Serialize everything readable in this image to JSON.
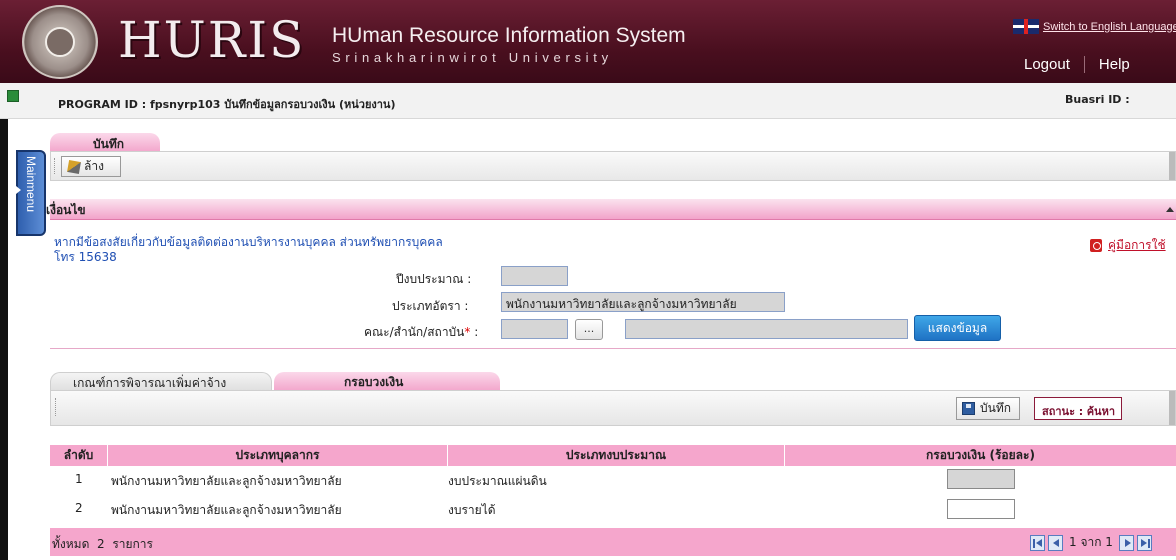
{
  "header": {
    "brand": "HURIS",
    "system_title": "HUman Resource Information System",
    "system_subtitle": "Srinakharinwirot University",
    "switch_language": "Switch to English Language",
    "nav": {
      "logout": "Logout",
      "help": "Help"
    }
  },
  "program_bar": {
    "program_id": "PROGRAM ID : fpsnyrp103 บันทึกข้อมูลกรอบวงเงิน (หน่วยงาน)",
    "buasri_label": "Buasri ID :"
  },
  "sidebar": {
    "mainmenu_label": "Mainmenu"
  },
  "save_tab": {
    "label": "บันทึก"
  },
  "toolbar": {
    "clear_label": "ล้าง"
  },
  "condition": {
    "title": "เงื่อนไข",
    "contact_line1": "หากมีข้อสงสัยเกี่ยวกับข้อมูลติดต่องานบริหารงานบุคคล ส่วนทรัพยากรบุคคล",
    "contact_line2": "โทร 15638",
    "manual_link": "คู่มือการใช้",
    "fields": {
      "fiscal_year_label": "ปีงบประมาณ :",
      "fiscal_year_value": "",
      "rate_type_label": "ประเภทอัตรา :",
      "rate_type_value": "พนักงานมหาวิทยาลัยและลูกจ้างมหาวิทยาลัย",
      "faculty_label": "คณะ/สำนัก/สถาบัน",
      "faculty_required_mark": "*",
      "faculty_colon": " :",
      "faculty_code_value": "",
      "faculty_name_value": "",
      "browse_label": "..."
    },
    "show_button": "แสดงข้อมูล"
  },
  "lower_tabs": {
    "criteria": "เกณฑ์การพิจารณาเพิ่มค่าจ้าง",
    "budget": "กรอบวงเงิน"
  },
  "toolbar2": {
    "save_label": "บันทึก",
    "status_label": "สถานะ :",
    "status_value": "ค้นหา"
  },
  "table": {
    "columns": [
      "ลำดับ",
      "ประเภทบุคลากร",
      "ประเภทงบประมาณ",
      "กรอบวงเงิน (ร้อยละ)"
    ],
    "rows": [
      {
        "no": "1",
        "person_type": "พนักงานมหาวิทยาลัยและลูกจ้างมหาวิทยาลัย",
        "budget_type": "งบประมาณแผ่นดิน",
        "percent": ""
      },
      {
        "no": "2",
        "person_type": "พนักงานมหาวิทยาลัยและลูกจ้างมหาวิทยาลัย",
        "budget_type": "งบรายได้",
        "percent": ""
      }
    ]
  },
  "footer": {
    "total_label": "ทั้งหมด",
    "total_count": "2",
    "total_unit": "รายการ",
    "pager": "1 จาก 1"
  }
}
